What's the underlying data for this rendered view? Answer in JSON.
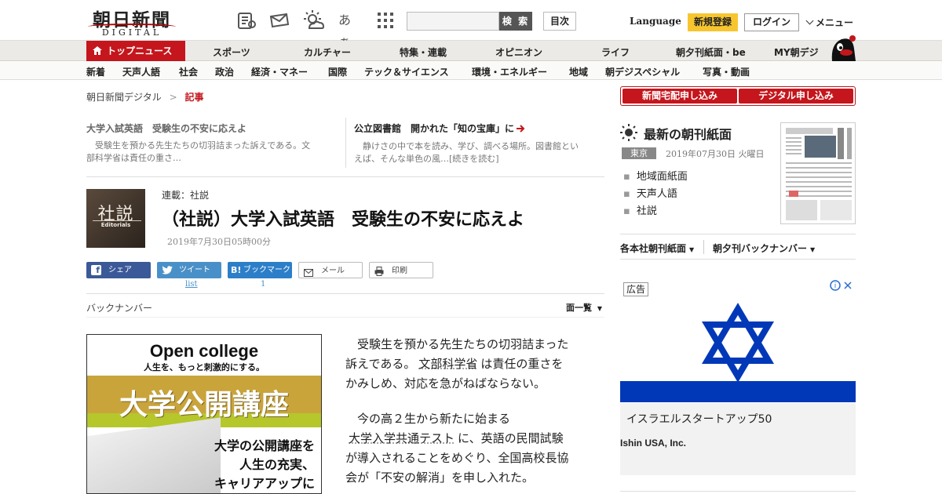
{
  "header": {
    "logo_kanji": "朝日新聞",
    "logo_digital": "DIGITAL",
    "font_toggle": "あぁ",
    "search_button": "検 索",
    "index_button": "目次",
    "language": "Language",
    "register": "新規登録",
    "login": "ログイン",
    "menu": "メニュー"
  },
  "nav": {
    "top": "トップニュース",
    "items": [
      "スポーツ",
      "カルチャー",
      "特集・連載",
      "オピニオン",
      "ライフ",
      "朝夕刊紙面・be",
      "MY朝デジ"
    ]
  },
  "subnav": [
    "新着",
    "天声人語",
    "社会",
    "政治",
    "経済・マネー",
    "国際",
    "テック＆サイエンス",
    "環境・エネルギー",
    "地域",
    "朝デジスペシャル",
    "写真・動画"
  ],
  "breadcrumb": {
    "home": "朝日新聞デジタル",
    "sep": ">",
    "current": "記事"
  },
  "teasers": [
    {
      "title": "大学入試英語　受験生の不安に応えよ",
      "body1": "　受験生を預かる先生たちの切羽詰まった訴えである。文",
      "body2": "部科学省は責任の重さ…"
    },
    {
      "title": "公立図書館　開かれた「知の宝庫」に",
      "body1": "　静けさの中で本を読み、学び、調べる場所。図書館とい",
      "body2": "えば、そんな単色の風…[続きを読む]"
    }
  ],
  "article": {
    "thumb_text": "社説",
    "thumb_sub": "Editorials",
    "series": "連載：社説",
    "title": "（社説）大学入試英語　受験生の不安に応えよ",
    "date": "2019年7月30日05時00分",
    "p1": [
      "　受験生を預かる先生たちの切羽詰まった",
      "訴えである。",
      "文部科学省",
      "は責任の重さを",
      "かみしめ、対応を急がねばならない。"
    ],
    "p2": [
      "　今の高２生から新たに始まる",
      "大学入学共通テスト",
      "に、英語の民間試験",
      "が導入されることをめぐり、全国高校長協",
      "会が「不安の解消」を申し入れた。"
    ]
  },
  "share": [
    {
      "label": "シェア",
      "count": ""
    },
    {
      "label": "ツイート",
      "count": "list"
    },
    {
      "label": "ブックマーク",
      "count": "1"
    },
    {
      "label": "メール",
      "count": ""
    },
    {
      "label": "印刷",
      "count": ""
    }
  ],
  "backnumber": "バックナンバー",
  "ichiran": "面一覧",
  "ad_left": {
    "headline": "Open college",
    "tagline": "人生を、もっと刺激的にする。",
    "big": "大学公開講座",
    "copy1": "大学の公開講座を",
    "copy2": "人生の充実、",
    "copy3": "キャリアアップに"
  },
  "right": {
    "btn1": "新聞宅配申し込み",
    "btn2": "デジタル申し込み",
    "choukan_title": "最新の朝刊紙面",
    "region": "東京",
    "date": "2019年07月30日 火曜日",
    "links": [
      "地域面紙面",
      "天声人語",
      "社説"
    ],
    "kakusha": "各本社朝刊紙面",
    "yuukan": "朝夕刊バックナンバー"
  },
  "ad_right": {
    "label": "広告",
    "headline": "イスラエルスタートアップ50",
    "sponsor": "Ishin USA, Inc."
  },
  "colors": {
    "brand_red": "#c4161c",
    "register_yellow": "#f7c62f",
    "facebook": "#3b5998",
    "twitter": "#1da1f2",
    "hatena": "#00a4de",
    "israel_blue": "#0038b8"
  }
}
